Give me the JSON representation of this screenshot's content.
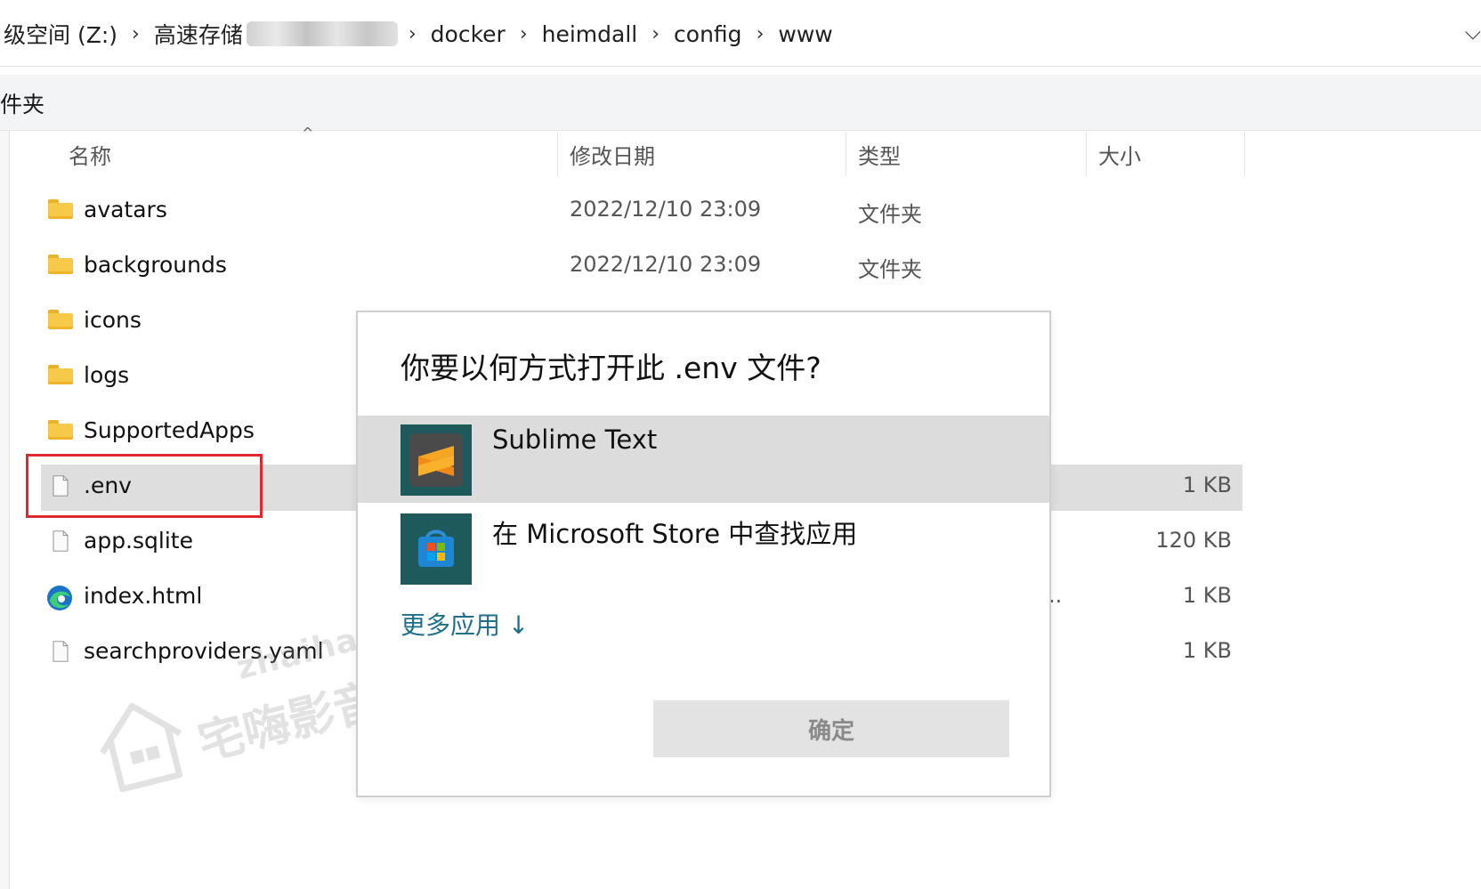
{
  "address_bar": {
    "crumbs": [
      "级空间 (Z:)",
      "高速存储",
      "docker",
      "heimdall",
      "config",
      "www"
    ],
    "separator": "›",
    "dropdown": "⌵"
  },
  "toolbar": {
    "label": "件夹"
  },
  "columns": {
    "name": "名称",
    "date": "修改日期",
    "type": "类型",
    "size": "大小",
    "sort_indicator": "^"
  },
  "files": [
    {
      "name": "avatars",
      "date": "2022/12/10 23:09",
      "type": "文件夹",
      "size": "",
      "icon": "folder-icon"
    },
    {
      "name": "backgrounds",
      "date": "2022/12/10 23:09",
      "type": "文件夹",
      "size": "",
      "icon": "folder-icon"
    },
    {
      "name": "icons",
      "date": "",
      "type": "",
      "size": "",
      "icon": "folder-icon"
    },
    {
      "name": "logs",
      "date": "",
      "type": "",
      "size": "",
      "icon": "folder-icon"
    },
    {
      "name": "SupportedApps",
      "date": "",
      "type": "",
      "size": "",
      "icon": "folder-icon"
    },
    {
      "name": ".env",
      "date": "",
      "type": "",
      "size": "1 KB",
      "icon": "file-icon"
    },
    {
      "name": "app.sqlite",
      "date": "",
      "type": "",
      "size": "120 KB",
      "icon": "file-icon"
    },
    {
      "name": "index.html",
      "date": "",
      "type": "..",
      "size": "1 KB",
      "icon": "edge-icon"
    },
    {
      "name": "searchproviders.yaml",
      "date": "",
      "type": "",
      "size": "1 KB",
      "icon": "file-icon"
    }
  ],
  "dialog": {
    "title": "你要以何方式打开此 .env 文件?",
    "apps": [
      {
        "name": "Sublime Text",
        "icon": "sublime-text-icon"
      },
      {
        "name": "在 Microsoft Store 中查找应用",
        "icon": "microsoft-store-icon"
      }
    ],
    "more_apps": "更多应用 ↓",
    "ok_label": "确定"
  },
  "watermark": {
    "url": "zhaihai.com",
    "text": "宅嗨影音社区"
  },
  "colors": {
    "selection": "#dedede",
    "highlight_border": "#e0262f",
    "link": "#1f6f8b",
    "folder": "#f7c948"
  }
}
